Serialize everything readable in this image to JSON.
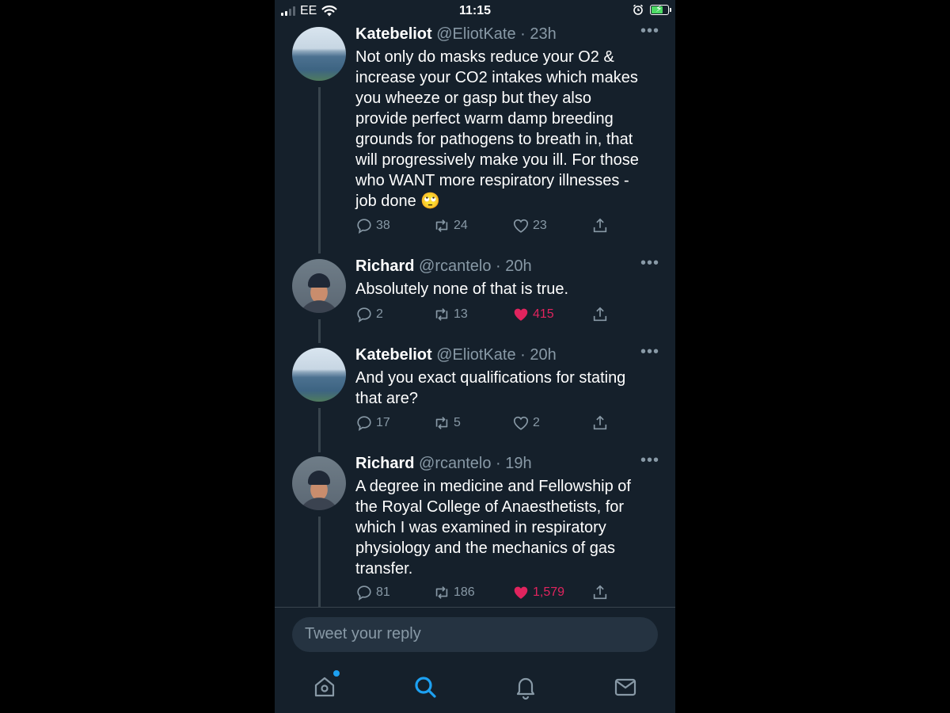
{
  "status_bar": {
    "carrier": "EE",
    "time": "11:15",
    "battery": 0.75
  },
  "tweets": [
    {
      "name": "Katebeliot",
      "meta": "@EliotKate · 23h",
      "lines": [
        "Not only do masks reduce your O2 &",
        "increase your CO2 intakes which makes",
        "you wheeze or gasp but they also",
        "provide perfect warm damp breeding",
        "grounds for pathogens to breath in, that",
        "will progressively make you ill. For those",
        "who WANT more respiratory illnesses -",
        "job done 🙄"
      ],
      "replies": "38",
      "retweets": "24",
      "likes": "23",
      "liked": false
    },
    {
      "name": "Richard",
      "meta": "@rcantelo · 20h",
      "lines": [
        "Absolutely none of that is true."
      ],
      "replies": "2",
      "retweets": "13",
      "likes": "415",
      "liked": true
    },
    {
      "name": "Katebeliot",
      "meta": "@EliotKate · 20h",
      "lines": [
        "And you exact qualifications for stating",
        "that are?"
      ],
      "replies": "17",
      "retweets": "5",
      "likes": "2",
      "liked": false
    },
    {
      "name": "Richard",
      "meta": "@rcantelo · 19h",
      "lines": [
        "A degree in medicine and Fellowship of",
        "the Royal College of Anaesthetists, for",
        "which I was examined in respiratory",
        "physiology and the mechanics of gas",
        "transfer."
      ],
      "replies": "81",
      "retweets": "186",
      "likes": "1,579",
      "liked": true
    }
  ],
  "reply_box": {
    "placeholder": "Tweet your reply"
  },
  "tab_bar": {
    "tabs": [
      "home-icon",
      "search-icon",
      "bell-icon",
      "mail-icon"
    ],
    "active": "search-icon",
    "active_color": "#1da1f2"
  },
  "colors": {
    "background": "#15202b",
    "muted": "#8899a6",
    "like": "#e0245e"
  }
}
